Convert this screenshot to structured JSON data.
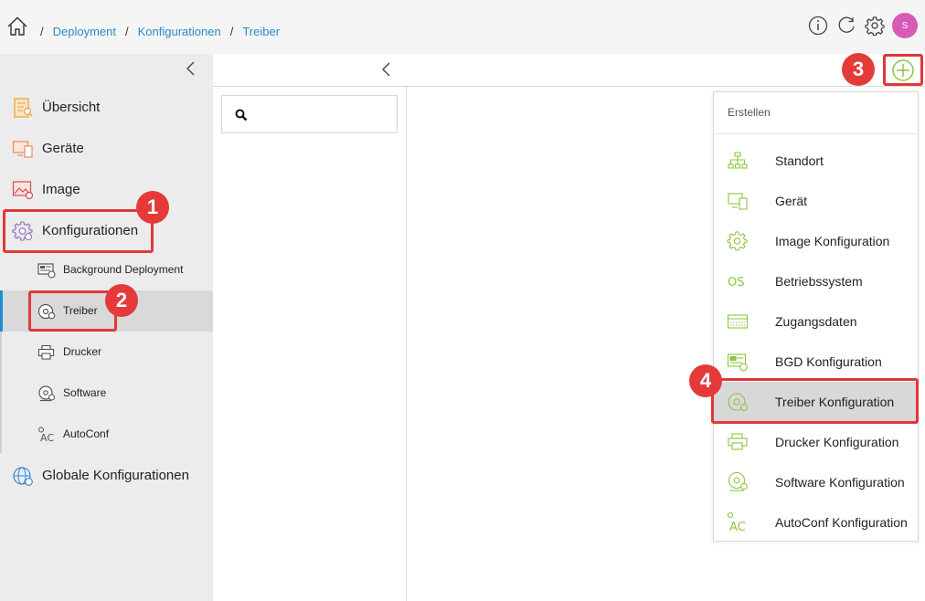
{
  "breadcrumb": {
    "separator": "/",
    "items": [
      "Deployment",
      "Konfigurationen",
      "Treiber"
    ]
  },
  "user": {
    "avatar_initial": "S",
    "avatar_color": "#d85ab8"
  },
  "colors": {
    "link": "#2a8ac8",
    "accent_green": "#8cc63f",
    "callout_red": "#e53a3a",
    "active_bar": "#1f8ed6"
  },
  "sidebar": {
    "items": [
      {
        "label": "Übersicht",
        "icon": "overview-icon"
      },
      {
        "label": "Geräte",
        "icon": "devices-icon"
      },
      {
        "label": "Image",
        "icon": "image-icon"
      },
      {
        "label": "Konfigurationen",
        "icon": "config-gear-icon"
      }
    ],
    "sub_items": [
      {
        "label": "Background Deployment",
        "icon": "background-deployment-icon"
      },
      {
        "label": "Treiber",
        "icon": "driver-disc-icon",
        "active": true
      },
      {
        "label": "Drucker",
        "icon": "printer-icon"
      },
      {
        "label": "Software",
        "icon": "software-disc-icon"
      },
      {
        "label": "AutoConf",
        "icon": "autoconf-icon"
      }
    ],
    "global": {
      "label": "Globale Konfigurationen",
      "icon": "global-config-icon"
    }
  },
  "dropdown": {
    "header": "Erstellen",
    "items": [
      {
        "label": "Standort",
        "icon": "location-tree-icon"
      },
      {
        "label": "Gerät",
        "icon": "device-icon"
      },
      {
        "label": "Image Konfiguration",
        "icon": "image-config-icon"
      },
      {
        "label": "Betriebssystem",
        "icon": "os-icon",
        "icon_text": "OS"
      },
      {
        "label": "Zugangsdaten",
        "icon": "credentials-icon"
      },
      {
        "label": "BGD Konfiguration",
        "icon": "bgd-config-icon"
      },
      {
        "label": "Treiber Konfiguration",
        "icon": "driver-config-icon",
        "highlighted": true
      },
      {
        "label": "Drucker Konfiguration",
        "icon": "printer-config-icon"
      },
      {
        "label": "Software Konfiguration",
        "icon": "software-config-icon"
      },
      {
        "label": "AutoConf Konfiguration",
        "icon": "autoconf-config-icon",
        "icon_text": "AC"
      }
    ]
  },
  "callouts": [
    "1",
    "2",
    "3",
    "4"
  ]
}
